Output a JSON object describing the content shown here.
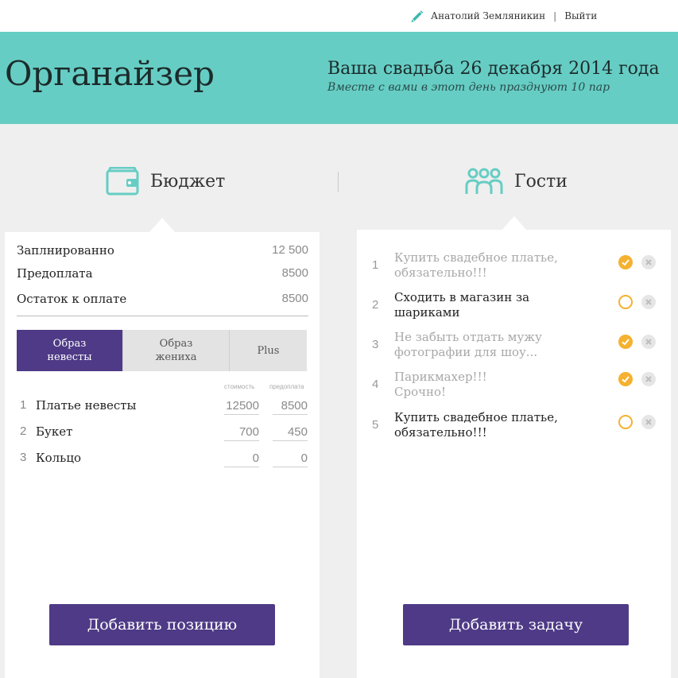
{
  "header": {
    "user_name": "Анатолий Земляникин",
    "separator": "|",
    "logout": "Выйти"
  },
  "hero": {
    "logo": "Органайзер",
    "title": "Ваша свадьба 26 декабря 2014 года",
    "subtitle": "Вместе с вами в этот день празднуют 10 пар"
  },
  "budget": {
    "heading": "Бюджет",
    "icon": "wallet-icon",
    "summary": [
      {
        "label": "Заплнированно",
        "value": "12 500"
      },
      {
        "label": "Предоплата",
        "value": "8500"
      },
      {
        "label": "Остаток к оплате",
        "value": "8500"
      }
    ],
    "tabs": [
      {
        "label": "Образ невесты",
        "active": true
      },
      {
        "label": "Образ жениха",
        "active": false
      },
      {
        "label": "Plus",
        "active": false
      }
    ],
    "columns": {
      "cost": "стоимость",
      "prepaid": "предоплата"
    },
    "items": [
      {
        "num": "1",
        "name": "Платье невесты",
        "cost": "12500",
        "prepaid": "8500"
      },
      {
        "num": "2",
        "name": "Букет",
        "cost": "700",
        "prepaid": "450"
      },
      {
        "num": "3",
        "name": "Кольцо",
        "cost": "0",
        "prepaid": "0"
      }
    ],
    "add_button": "Добавить позицию"
  },
  "guests": {
    "heading": "Гости",
    "icon": "people-icon",
    "tasks": [
      {
        "num": "1",
        "text": "Купить свадебное платье, обязательно!!!",
        "done": true
      },
      {
        "num": "2",
        "text": "Сходить в магазин за шариками",
        "done": false
      },
      {
        "num": "3",
        "text": "Не забыть отдать мужу фотографии для шоу...",
        "done": true
      },
      {
        "num": "4",
        "text": "Парикмахер!!! Срочно!",
        "done": true
      },
      {
        "num": "5",
        "text": "Купить свадебное платье, обязательно!!!",
        "done": false
      }
    ],
    "add_button": "Добавить задачу"
  },
  "colors": {
    "teal": "#66cdc4",
    "purple": "#4e3a86",
    "orange": "#f5b12f",
    "background": "#efefef"
  }
}
